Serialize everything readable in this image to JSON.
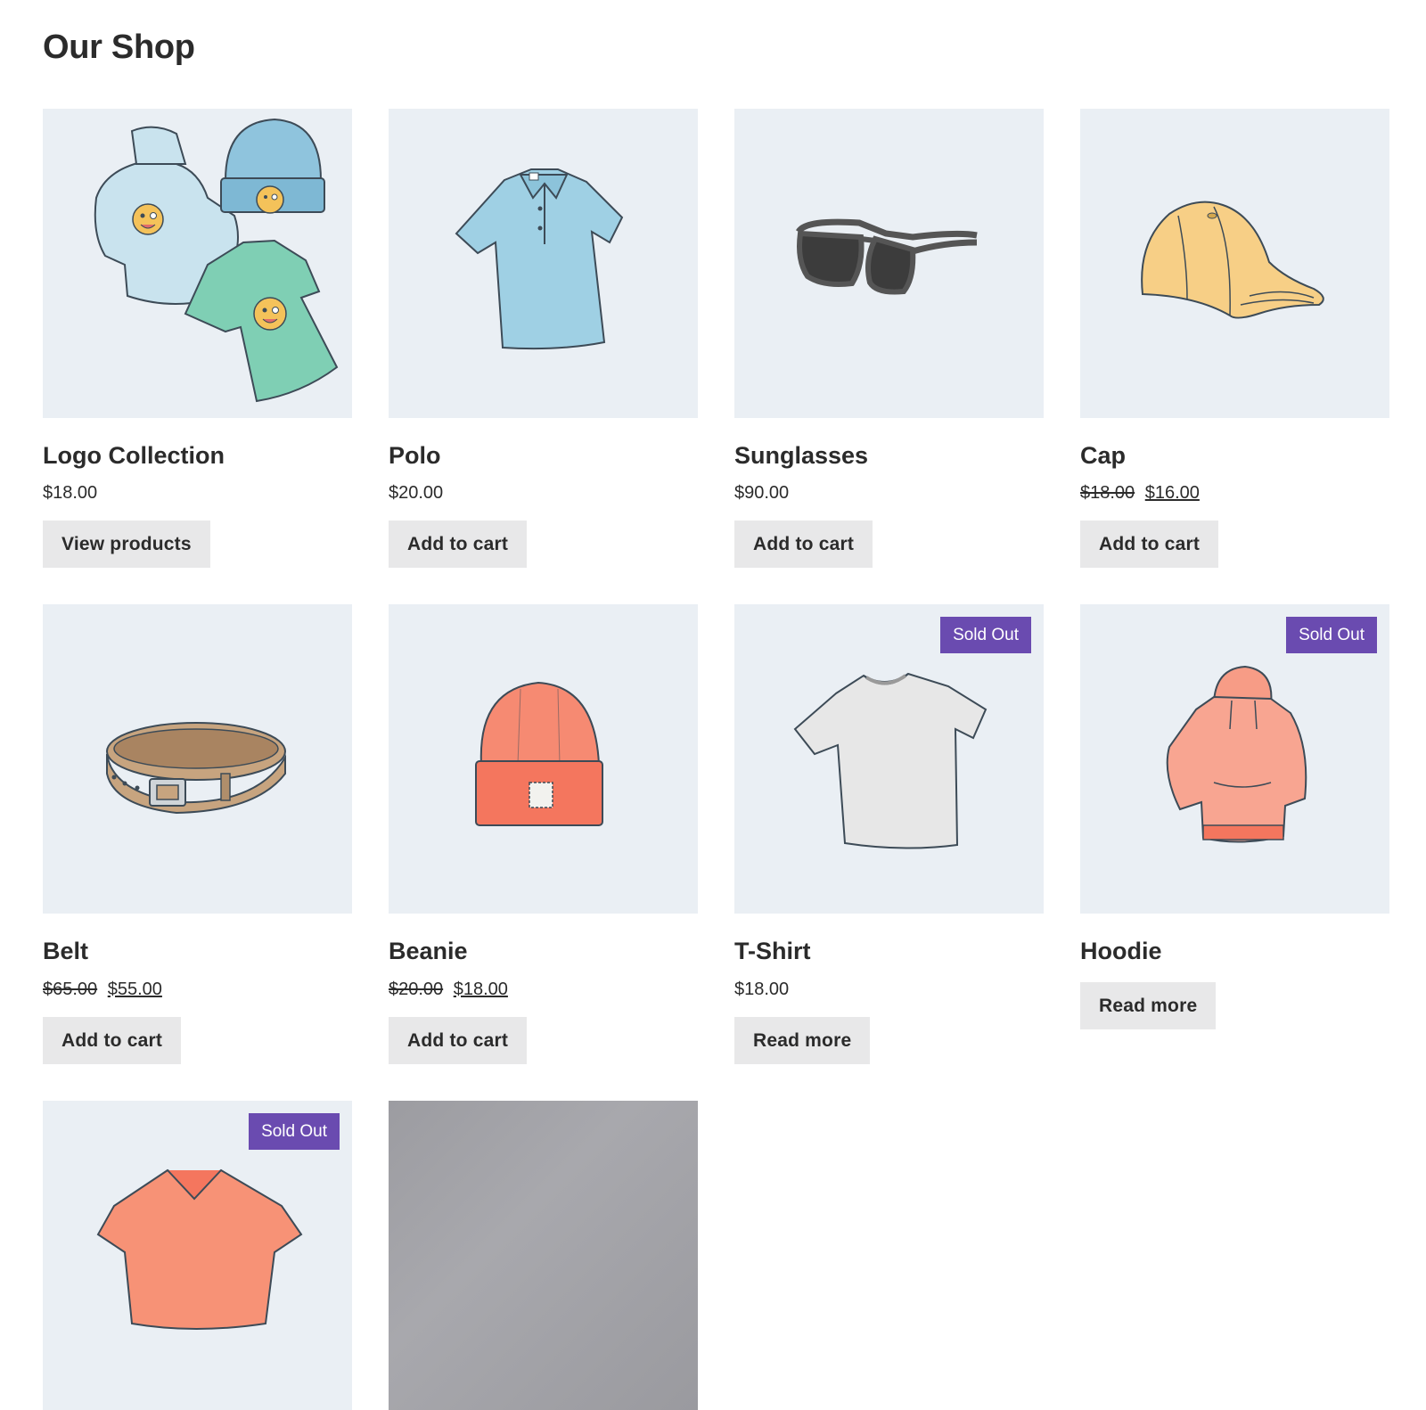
{
  "page": {
    "title": "Our Shop"
  },
  "colors": {
    "thumb_bg": "#eaeff4",
    "badge_bg": "#6a4bb0",
    "button_bg": "#e8e8e9",
    "text": "#2b2b2b"
  },
  "products": [
    {
      "name": "Logo Collection",
      "price": "$18.00",
      "old_price": "",
      "sale_price": "",
      "button": "View products",
      "badge": "",
      "icon": "logo-collection-icon"
    },
    {
      "name": "Polo",
      "price": "$20.00",
      "old_price": "",
      "sale_price": "",
      "button": "Add to cart",
      "badge": "",
      "icon": "polo-shirt-icon"
    },
    {
      "name": "Sunglasses",
      "price": "$90.00",
      "old_price": "",
      "sale_price": "",
      "button": "Add to cart",
      "badge": "",
      "icon": "sunglasses-icon"
    },
    {
      "name": "Cap",
      "price": "",
      "old_price": "$18.00",
      "sale_price": "$16.00",
      "button": "Add to cart",
      "badge": "",
      "icon": "cap-icon"
    },
    {
      "name": "Belt",
      "price": "",
      "old_price": "$65.00",
      "sale_price": "$55.00",
      "button": "Add to cart",
      "badge": "",
      "icon": "belt-icon"
    },
    {
      "name": "Beanie",
      "price": "",
      "old_price": "$20.00",
      "sale_price": "$18.00",
      "button": "Add to cart",
      "badge": "",
      "icon": "beanie-icon"
    },
    {
      "name": "T-Shirt",
      "price": "$18.00",
      "old_price": "",
      "sale_price": "",
      "button": "Read more",
      "badge": "Sold Out",
      "icon": "tshirt-icon"
    },
    {
      "name": "Hoodie",
      "price": "",
      "old_price": "",
      "sale_price": "",
      "button": "Read more",
      "badge": "Sold Out",
      "icon": "hoodie-icon"
    },
    {
      "name": "",
      "price": "",
      "old_price": "",
      "sale_price": "",
      "button": "",
      "badge": "Sold Out",
      "icon": "vneck-shirt-icon"
    },
    {
      "name": "",
      "price": "",
      "old_price": "",
      "sale_price": "",
      "button": "",
      "badge": "",
      "icon": "grey-image-placeholder"
    }
  ]
}
